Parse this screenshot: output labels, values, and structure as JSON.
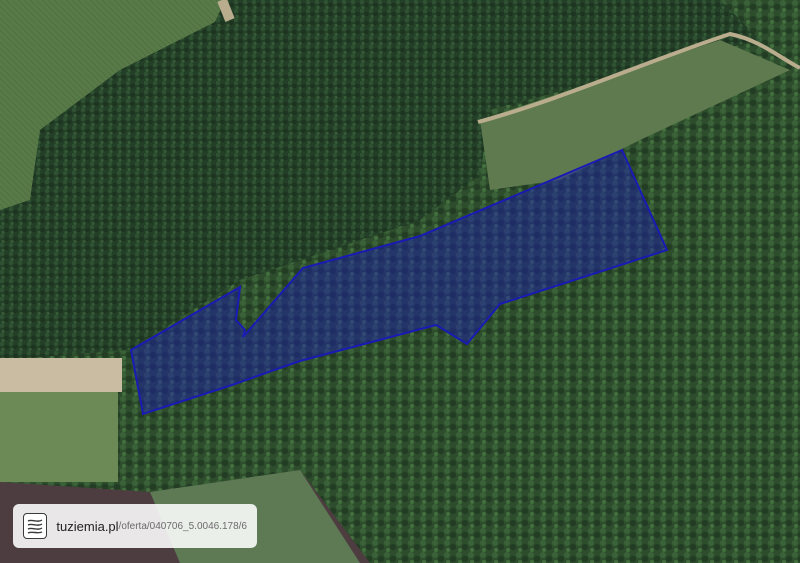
{
  "map": {
    "view": "satellite",
    "plot_outline_color": "#1a1ab4",
    "plot_fill_color": "#1a1ab4"
  },
  "watermark": {
    "icon": "contour-lines-logo-icon",
    "domain": "tuziemia.pl",
    "path": "/oferta/040706_5.0046.178/6"
  }
}
